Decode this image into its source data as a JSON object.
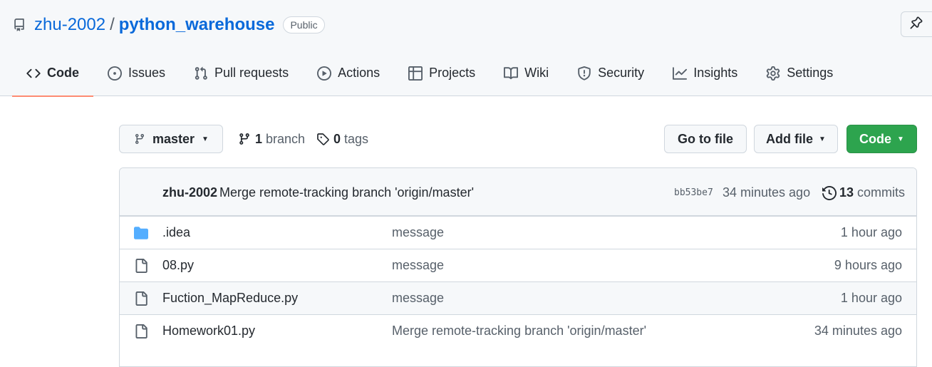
{
  "repo": {
    "owner": "zhu-2002",
    "separator": "/",
    "name": "python_warehouse",
    "visibility": "Public"
  },
  "tabs": [
    {
      "label": "Code",
      "icon": "code-icon",
      "selected": true
    },
    {
      "label": "Issues",
      "icon": "issue-opened-icon",
      "selected": false
    },
    {
      "label": "Pull requests",
      "icon": "git-pull-request-icon",
      "selected": false
    },
    {
      "label": "Actions",
      "icon": "play-icon",
      "selected": false
    },
    {
      "label": "Projects",
      "icon": "table-icon",
      "selected": false
    },
    {
      "label": "Wiki",
      "icon": "book-icon",
      "selected": false
    },
    {
      "label": "Security",
      "icon": "shield-icon",
      "selected": false
    },
    {
      "label": "Insights",
      "icon": "graph-icon",
      "selected": false
    },
    {
      "label": "Settings",
      "icon": "gear-icon",
      "selected": false
    }
  ],
  "toolbar": {
    "branch": "master",
    "branch_count": "1",
    "branch_label": "branch",
    "tag_count": "0",
    "tag_label": "tags",
    "goto_file": "Go to file",
    "add_file": "Add file",
    "code": "Code"
  },
  "latest_commit": {
    "author": "zhu-2002",
    "message": "Merge remote-tracking branch 'origin/master'",
    "sha": "bb53be7",
    "time": "34 minutes ago",
    "commit_count": "13",
    "commit_label": "commits"
  },
  "files": [
    {
      "type": "directory",
      "icon": "folder-icon",
      "name": ".idea",
      "message": "message",
      "age": "1 hour ago"
    },
    {
      "type": "file",
      "icon": "file-icon",
      "name": "08.py",
      "message": "message",
      "age": "9 hours ago"
    },
    {
      "type": "file",
      "icon": "file-icon",
      "name": "Fuction_MapReduce.py",
      "message": "message",
      "age": "1 hour ago"
    },
    {
      "type": "file",
      "icon": "file-icon",
      "name": "Homework01.py",
      "message": "Merge remote-tracking branch 'origin/master'",
      "age": "34 minutes ago"
    }
  ],
  "colors": {
    "link": "#0969da",
    "primary_button": "#2da44e",
    "selected_tab_underline": "#fd8c73",
    "folder": "#54aeff"
  }
}
